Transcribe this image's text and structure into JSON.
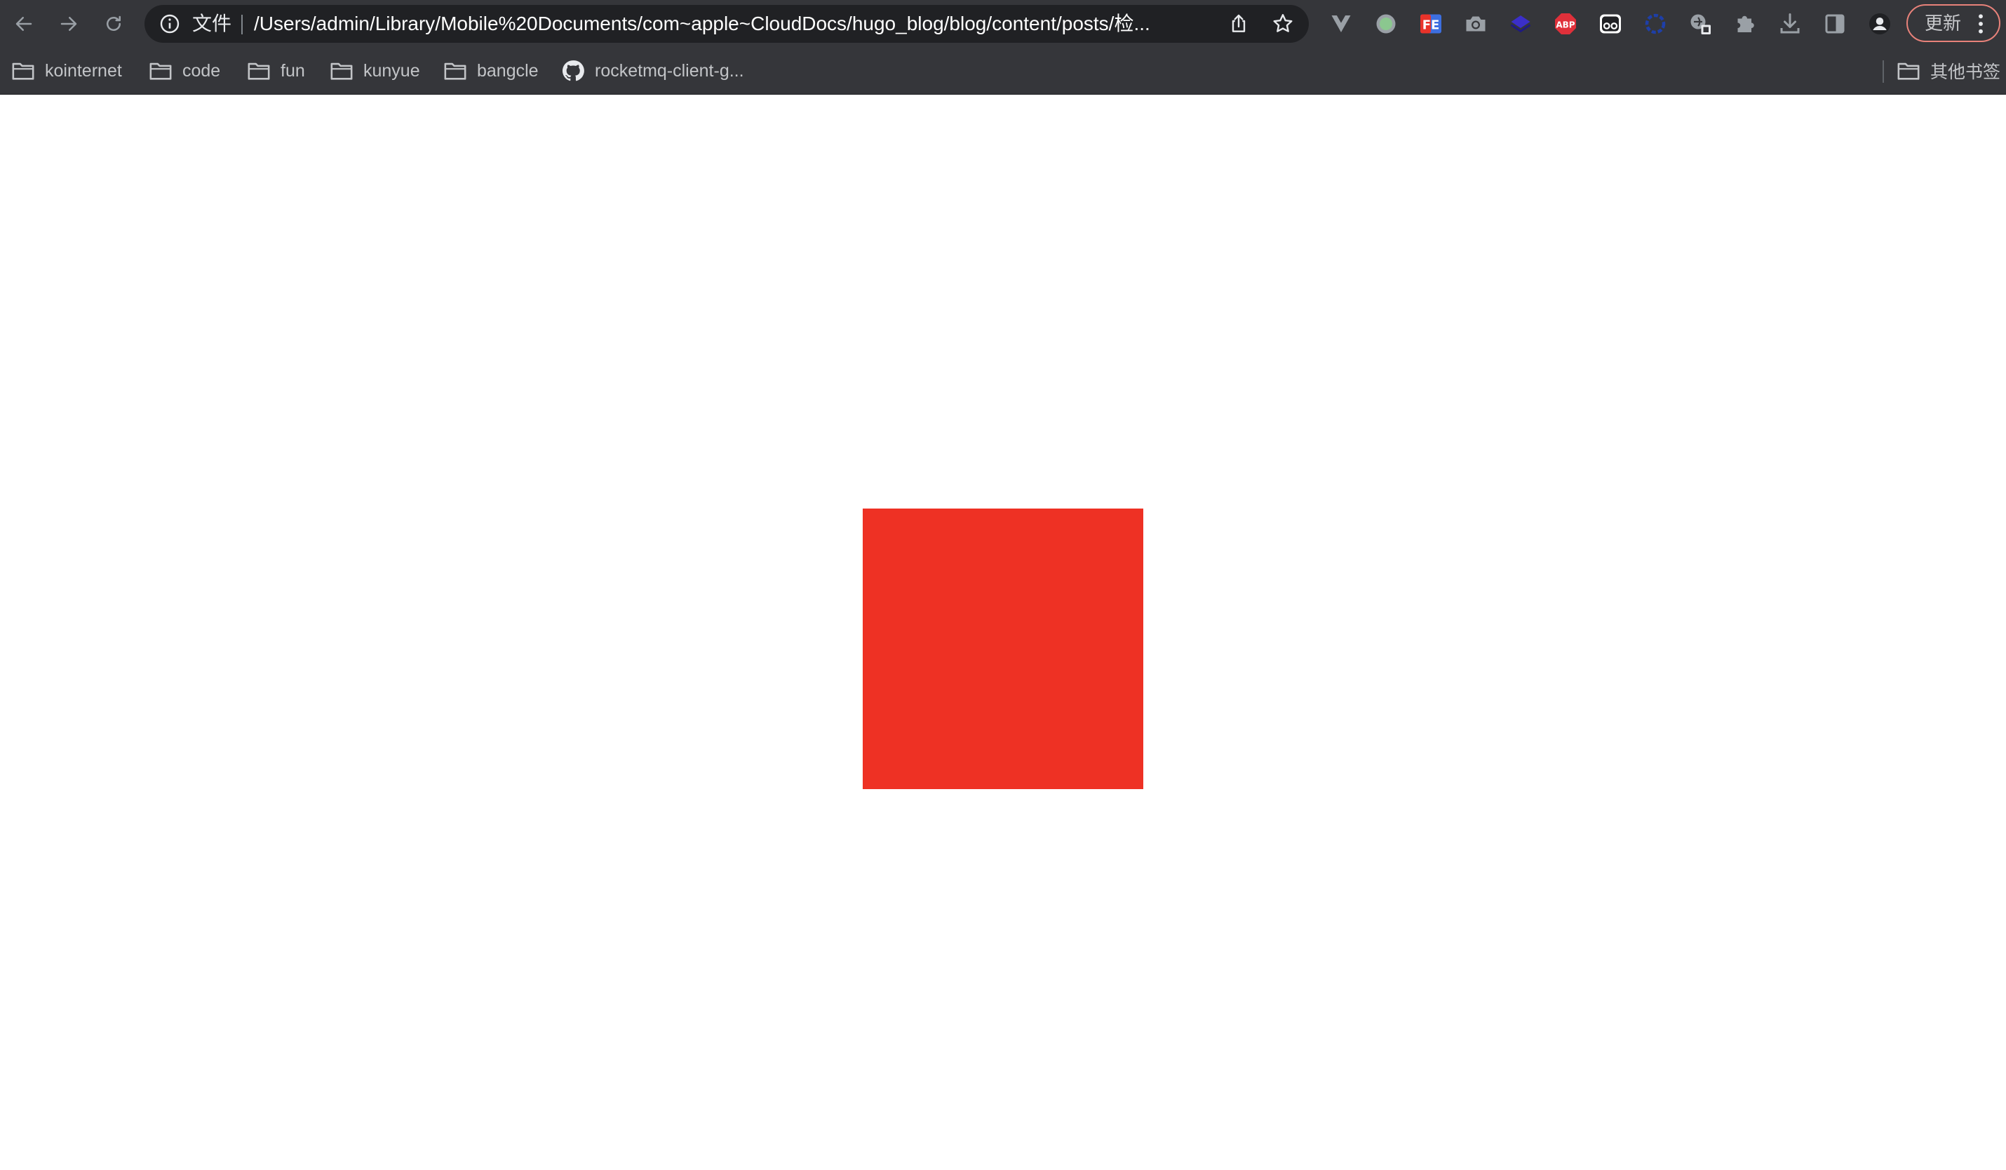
{
  "browser": {
    "omnibox": {
      "scheme_label": "文件",
      "url": "/Users/admin/Library/Mobile%20Documents/com~apple~CloudDocs/hugo_blog/blog/content/posts/检..."
    },
    "update_button": {
      "label": "更新"
    },
    "extensions": [
      {
        "icon": "vue-devtools-icon"
      },
      {
        "icon": "green-dot-extension-icon"
      },
      {
        "icon": "fe-helper-icon"
      },
      {
        "icon": "camera-icon"
      },
      {
        "icon": "layers-extension-icon"
      },
      {
        "icon": "adblock-plus-icon"
      },
      {
        "icon": "glasses-extension-icon"
      },
      {
        "icon": "blue-gear-extension-icon"
      },
      {
        "icon": "translate-extension-icon"
      },
      {
        "icon": "puzzle-piece-icon"
      },
      {
        "icon": "download-icon"
      },
      {
        "icon": "side-panel-icon"
      },
      {
        "icon": "profile-avatar-icon"
      }
    ]
  },
  "bookmarks": {
    "items": [
      {
        "label": "kointernet",
        "icon": "folder-icon"
      },
      {
        "label": "code",
        "icon": "folder-icon"
      },
      {
        "label": "fun",
        "icon": "folder-icon"
      },
      {
        "label": "kunyue",
        "icon": "folder-icon"
      },
      {
        "label": "bangcle",
        "icon": "folder-icon"
      },
      {
        "label": "rocketmq-client-g...",
        "icon": "github-icon"
      }
    ],
    "other_label": "其他书签"
  },
  "page": {
    "square_color": "#ee3124",
    "background_color": "#ffffff"
  }
}
